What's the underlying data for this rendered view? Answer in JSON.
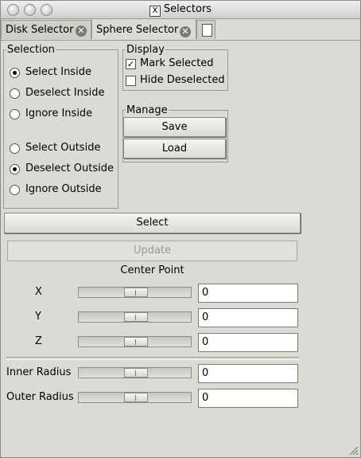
{
  "window": {
    "title": "Selectors"
  },
  "tabs": [
    {
      "label": "Disk Selector"
    },
    {
      "label": "Sphere Selector"
    }
  ],
  "selection": {
    "legend": "Selection",
    "options": [
      {
        "label": "Select Inside",
        "checked": true
      },
      {
        "label": "Deselect Inside",
        "checked": false
      },
      {
        "label": "Ignore Inside",
        "checked": false
      },
      {
        "label": "Select Outside",
        "checked": false
      },
      {
        "label": "Deselect Outside",
        "checked": true
      },
      {
        "label": "Ignore Outside",
        "checked": false
      }
    ]
  },
  "display": {
    "legend": "Display",
    "mark_selected": {
      "label": "Mark Selected",
      "checked": true
    },
    "hide_deselected": {
      "label": "Hide Deselected",
      "checked": false
    }
  },
  "manage": {
    "legend": "Manage",
    "save_label": "Save",
    "load_label": "Load"
  },
  "actions": {
    "select_label": "Select",
    "update_label": "Update"
  },
  "center_point": {
    "heading": "Center Point",
    "x": {
      "label": "X",
      "value": "0"
    },
    "y": {
      "label": "Y",
      "value": "0"
    },
    "z": {
      "label": "Z",
      "value": "0"
    }
  },
  "radius": {
    "inner": {
      "label": "Inner Radius",
      "value": "0"
    },
    "outer": {
      "label": "Outer Radius",
      "value": "0"
    }
  },
  "icons": {
    "tab_close": "close-icon",
    "new_tab": "new-document-icon",
    "title_app": "x11-icon",
    "resize": "resize-grip-icon"
  }
}
